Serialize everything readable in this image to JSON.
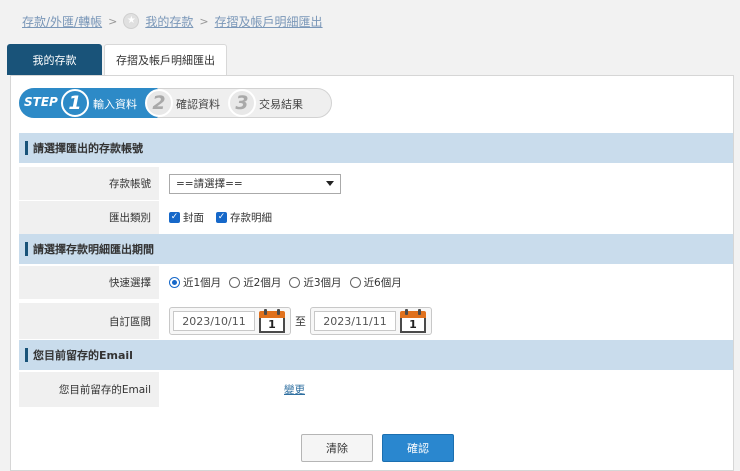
{
  "breadcrumb": {
    "items": [
      "存款/外匯/轉帳",
      "我的存款",
      "存摺及帳戶明細匯出"
    ],
    "sep": ">",
    "star_glyph": "★"
  },
  "tabs": [
    {
      "label": "我的存款",
      "active": true
    },
    {
      "label": "存摺及帳戶明細匯出",
      "active": false
    }
  ],
  "steps": {
    "prefix": "STEP",
    "items": [
      {
        "num": "1",
        "label": "輸入資料",
        "active": true
      },
      {
        "num": "2",
        "label": "確認資料",
        "active": false
      },
      {
        "num": "3",
        "label": "交易結果",
        "active": false
      }
    ]
  },
  "sections": {
    "account": {
      "title": "請選擇匯出的存款帳號",
      "account_label": "存款帳號",
      "account_select": "==請選擇==",
      "export_type_label": "匯出類別",
      "options": [
        {
          "label": "封面",
          "checked": true
        },
        {
          "label": "存款明細",
          "checked": true
        }
      ]
    },
    "period": {
      "title": "請選擇存款明細匯出期間",
      "quick_label": "快速選擇",
      "quick_options": [
        {
          "label": "近1個月",
          "selected": true
        },
        {
          "label": "近2個月",
          "selected": false
        },
        {
          "label": "近3個月",
          "selected": false
        },
        {
          "label": "近6個月",
          "selected": false
        }
      ],
      "custom_label": "自訂區間",
      "start_date": "2023/10/11",
      "to_text": "至",
      "end_date": "2023/11/11",
      "cal_num": "1"
    },
    "email": {
      "title": "您目前留存的Email",
      "label": "您目前留存的Email",
      "change_link": "變更"
    }
  },
  "buttons": {
    "clear": "清除",
    "confirm": "確認"
  },
  "colors": {
    "tab_active": "#195379",
    "section_header": "#c9dcec",
    "step_active": "#2d8ac7",
    "primary_button": "#2a87cf"
  }
}
